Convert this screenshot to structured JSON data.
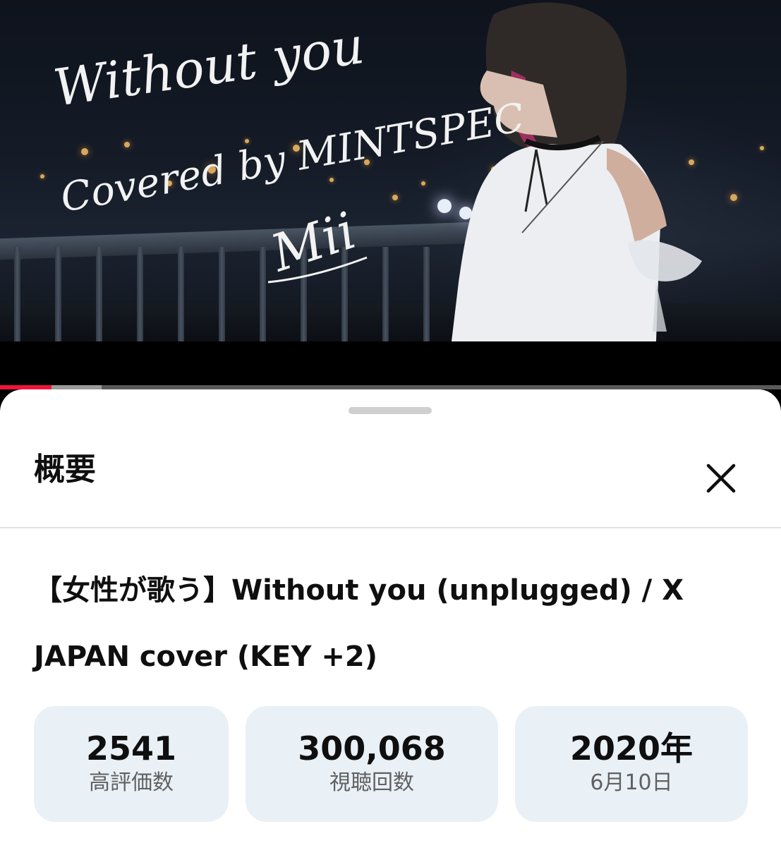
{
  "video": {
    "overlay_line1": "Without you",
    "overlay_line2": "Covered by MINTSPEC",
    "overlay_signature": "Mii",
    "progress_played": 0.066,
    "progress_buffered": 0.13
  },
  "sheet": {
    "title": "概要",
    "close_icon": "close-icon",
    "video_title": "【女性が歌う】Without you (unplugged) / X JAPAN cover (KEY +2)",
    "stats": [
      {
        "value": "2541",
        "label": "高評価数"
      },
      {
        "value": "300,068",
        "label": "視聴回数"
      },
      {
        "value": "2020年",
        "label": "6月10日"
      }
    ]
  },
  "colors": {
    "progress_red": "#f0143c",
    "stat_background": "#e9f0f6"
  }
}
